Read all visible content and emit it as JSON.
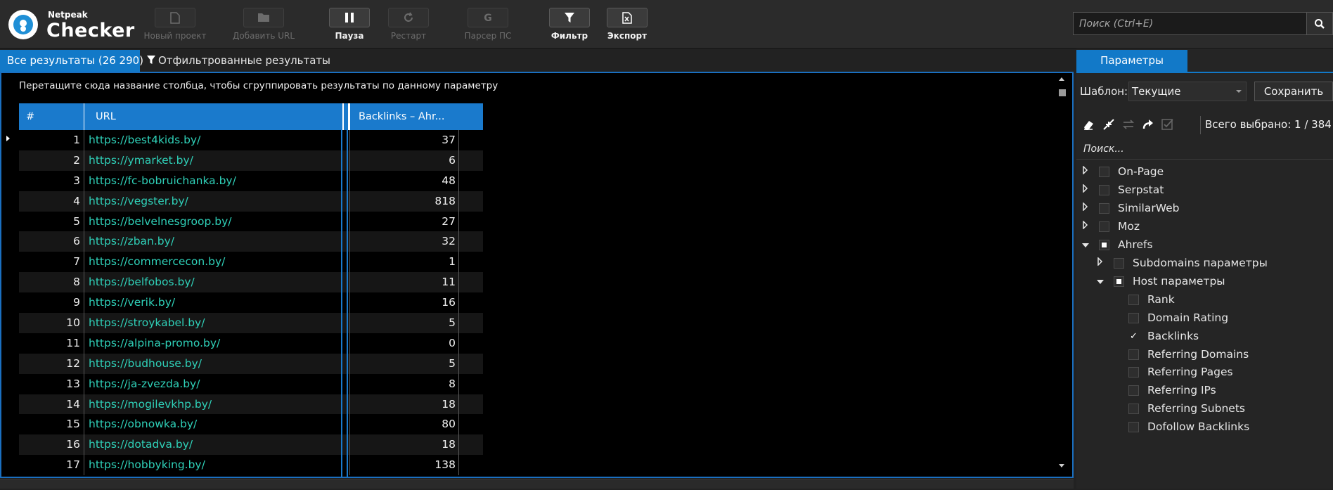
{
  "app": {
    "logo_small": "Netpeak",
    "logo_big": "Checker",
    "brand_color": "#1279c8"
  },
  "toolbar": {
    "buttons": [
      {
        "label": "Новый проект",
        "icon": "new-file-icon",
        "enabled": false
      },
      {
        "label": "Добавить URL",
        "icon": "folder-icon",
        "enabled": false
      },
      {
        "label": "Пауза",
        "icon": "pause-icon",
        "enabled": true
      },
      {
        "label": "Рестарт",
        "icon": "restart-icon",
        "enabled": false
      },
      {
        "label": "Парсер ПС",
        "icon": "google-g-icon",
        "enabled": false
      },
      {
        "label": "Фильтр",
        "icon": "filter-icon",
        "enabled": true
      },
      {
        "label": "Экспорт",
        "icon": "excel-export-icon",
        "enabled": true
      }
    ],
    "search_placeholder": "Поиск (Ctrl+E)"
  },
  "tabs": {
    "all": "Все результаты (26 290)",
    "filtered": "Отфильтрованные результаты"
  },
  "grid": {
    "group_hint": "Перетащите сюда название столбца, чтобы сгруппировать результаты по данному параметру",
    "columns": [
      "#",
      "URL",
      "Backlinks – Ahr..."
    ],
    "rows": [
      {
        "num": "1",
        "url": "https://best4kids.by/",
        "backlinks": "37"
      },
      {
        "num": "2",
        "url": "https://ymarket.by/",
        "backlinks": "6"
      },
      {
        "num": "3",
        "url": "https://fc-bobruichanka.by/",
        "backlinks": "48"
      },
      {
        "num": "4",
        "url": "https://vegster.by/",
        "backlinks": "818"
      },
      {
        "num": "5",
        "url": "https://belvelnesgroop.by/",
        "backlinks": "27"
      },
      {
        "num": "6",
        "url": "https://zban.by/",
        "backlinks": "32"
      },
      {
        "num": "7",
        "url": "https://commercecon.by/",
        "backlinks": "1"
      },
      {
        "num": "8",
        "url": "https://belfobos.by/",
        "backlinks": "11"
      },
      {
        "num": "9",
        "url": "https://verik.by/",
        "backlinks": "16"
      },
      {
        "num": "10",
        "url": "https://stroykabel.by/",
        "backlinks": "5"
      },
      {
        "num": "11",
        "url": "https://alpina-promo.by/",
        "backlinks": "0"
      },
      {
        "num": "12",
        "url": "https://budhouse.by/",
        "backlinks": "5"
      },
      {
        "num": "13",
        "url": "https://ja-zvezda.by/",
        "backlinks": "8"
      },
      {
        "num": "14",
        "url": "https://mogilevkhp.by/",
        "backlinks": "18"
      },
      {
        "num": "15",
        "url": "https://obnowka.by/",
        "backlinks": "80"
      },
      {
        "num": "16",
        "url": "https://dotadva.by/",
        "backlinks": "18"
      },
      {
        "num": "17",
        "url": "https://hobbyking.by/",
        "backlinks": "138"
      }
    ]
  },
  "params": {
    "tab_label": "Параметры",
    "template_label": "Шаблон:",
    "template_value": "Текущие",
    "save_label": "Сохранить",
    "total_selected": "Всего выбрано: 1 / 384",
    "search_placeholder": "Поиск...",
    "tree": [
      {
        "label": "On-Page",
        "level": 0,
        "expanded": false,
        "state": "none"
      },
      {
        "label": "Serpstat",
        "level": 0,
        "expanded": false,
        "state": "none"
      },
      {
        "label": "SimilarWeb",
        "level": 0,
        "expanded": false,
        "state": "none"
      },
      {
        "label": "Moz",
        "level": 0,
        "expanded": false,
        "state": "none"
      },
      {
        "label": "Ahrefs",
        "level": 0,
        "expanded": true,
        "state": "partial"
      },
      {
        "label": "Subdomains параметры",
        "level": 1,
        "expanded": false,
        "state": "none"
      },
      {
        "label": "Host параметры",
        "level": 1,
        "expanded": true,
        "state": "partial"
      },
      {
        "label": "Rank",
        "level": 2,
        "state": "none"
      },
      {
        "label": "Domain Rating",
        "level": 2,
        "state": "none"
      },
      {
        "label": "Backlinks",
        "level": 2,
        "state": "checked"
      },
      {
        "label": "Referring Domains",
        "level": 2,
        "state": "none"
      },
      {
        "label": "Referring Pages",
        "level": 2,
        "state": "none"
      },
      {
        "label": "Referring IPs",
        "level": 2,
        "state": "none"
      },
      {
        "label": "Referring Subnets",
        "level": 2,
        "state": "none"
      },
      {
        "label": "Dofollow Backlinks",
        "level": 2,
        "state": "none"
      }
    ]
  }
}
